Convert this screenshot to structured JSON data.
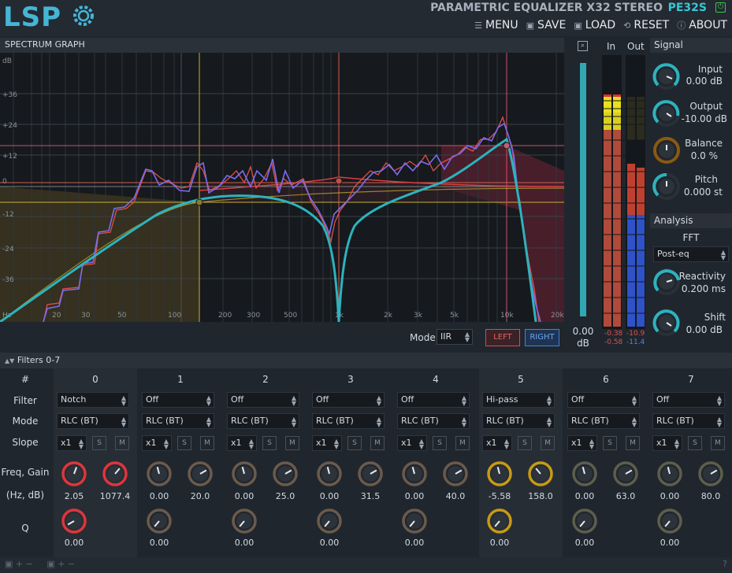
{
  "header": {
    "logo": "LSP",
    "plugin_title": "PARAMETRIC EQUALIZER X32 STEREO",
    "plugin_id": "PE32S",
    "menu": [
      {
        "icon": "menu-icon",
        "label": "MENU"
      },
      {
        "icon": "save-icon",
        "label": "SAVE"
      },
      {
        "icon": "load-icon",
        "label": "LOAD"
      },
      {
        "icon": "reset-icon",
        "label": "RESET"
      },
      {
        "icon": "about-icon",
        "label": "ABOUT"
      }
    ]
  },
  "graph": {
    "title": "SPECTRUM GRAPH",
    "db_unit": "dB",
    "db_labels": [
      "+36",
      "+24",
      "+12",
      "0",
      "-12",
      "-24",
      "-36"
    ],
    "hz_unit": "Hz",
    "freq_labels": [
      "20",
      "30",
      "50",
      "100",
      "200",
      "300",
      "500",
      "1k",
      "2k",
      "3k",
      "5k",
      "10k",
      "20k"
    ],
    "mode_label": "Mode",
    "mode_value": "IIR",
    "left_button": "LEFT",
    "right_button": "RIGHT"
  },
  "zoom": {
    "value": "0.00",
    "unit": "dB"
  },
  "meters": {
    "in_label": "In",
    "out_label": "Out",
    "in_peak_l": "-0.38",
    "in_peak_r": "-0.58",
    "out_peak_l": "-10.9",
    "out_peak_r": "-11.4"
  },
  "signal": {
    "title": "Signal",
    "input_label": "Input",
    "input_value": "0.00 dB",
    "output_label": "Output",
    "output_value": "-10.00 dB",
    "balance_label": "Balance",
    "balance_value": "0.0 %",
    "pitch_label": "Pitch",
    "pitch_value": "0.000 st"
  },
  "analysis": {
    "title": "Analysis",
    "fft_label": "FFT",
    "fft_value": "Post-eq",
    "reactivity_label": "Reactivity",
    "reactivity_value": "0.200 ms",
    "shift_label": "Shift",
    "shift_value": "0.00 dB"
  },
  "filters": {
    "title": "Filters 0-7",
    "row_labels": {
      "num": "#",
      "filter": "Filter",
      "mode": "Mode",
      "slope": "Slope",
      "freq_gain": "Freq, Gain",
      "units": "(Hz, dB)",
      "q": "Q"
    },
    "sm": {
      "s": "S",
      "m": "M"
    },
    "bands": [
      {
        "num": "0",
        "filter": "Notch",
        "mode": "RLC (BT)",
        "slope": "x1",
        "freq": "2.05",
        "gain": "1077.4",
        "q": "0.00",
        "color": "#e0353a"
      },
      {
        "num": "1",
        "filter": "Off",
        "mode": "RLC (BT)",
        "slope": "x1",
        "freq": "0.00",
        "gain": "20.0",
        "q": "0.00",
        "color": "#6b5a4c"
      },
      {
        "num": "2",
        "filter": "Off",
        "mode": "RLC (BT)",
        "slope": "x1",
        "freq": "0.00",
        "gain": "25.0",
        "q": "0.00",
        "color": "#6b5a4c"
      },
      {
        "num": "3",
        "filter": "Off",
        "mode": "RLC (BT)",
        "slope": "x1",
        "freq": "0.00",
        "gain": "31.5",
        "q": "0.00",
        "color": "#6b5a4c"
      },
      {
        "num": "4",
        "filter": "Off",
        "mode": "RLC (BT)",
        "slope": "x1",
        "freq": "0.00",
        "gain": "40.0",
        "q": "0.00",
        "color": "#6b5a4c"
      },
      {
        "num": "5",
        "filter": "Hi-pass",
        "mode": "RLC (BT)",
        "slope": "x1",
        "freq": "-5.58",
        "gain": "158.0",
        "q": "0.00",
        "color": "#c89a14"
      },
      {
        "num": "6",
        "filter": "Off",
        "mode": "RLC (BT)",
        "slope": "x1",
        "freq": "0.00",
        "gain": "63.0",
        "q": "0.00",
        "color": "#5e5e4c"
      },
      {
        "num": "7",
        "filter": "Off",
        "mode": "RLC (BT)",
        "slope": "x1",
        "freq": "0.00",
        "gain": "80.0",
        "q": "0.00",
        "color": "#5e5e4c"
      }
    ]
  },
  "colors": {
    "accent": "#38c7d6",
    "curve": "#2db3bd",
    "spectrum": "#7a6cf0",
    "left": "#e04646",
    "right": "#3f84dd"
  }
}
